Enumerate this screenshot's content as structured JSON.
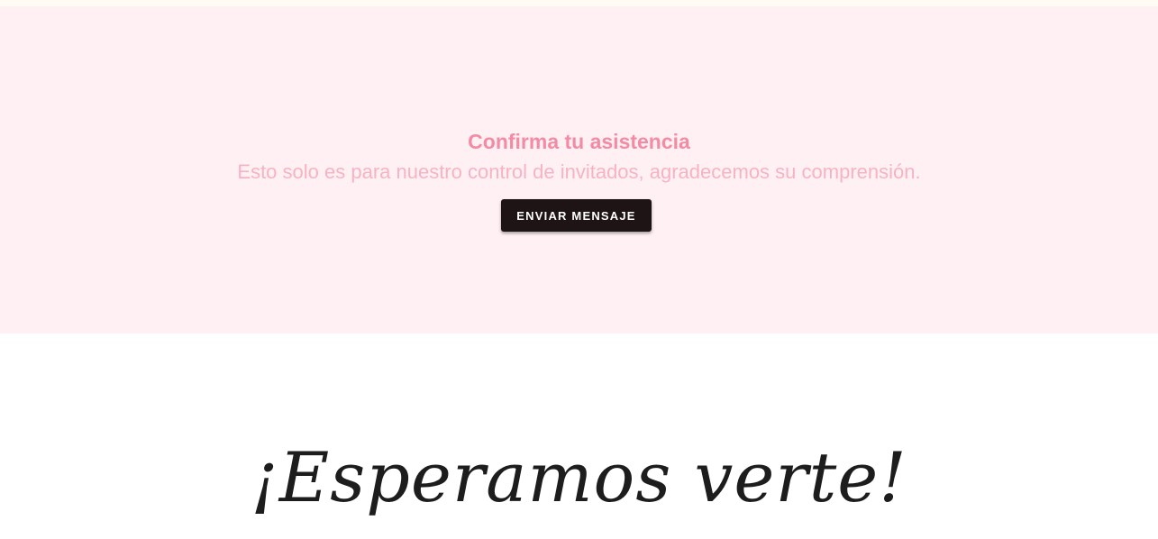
{
  "rsvp": {
    "title": "Confirma tu asistencia",
    "subtitle": "Esto solo es para nuestro control de invitados, agradecemos su comprensión.",
    "button_label": "ENVIAR MENSAJE"
  },
  "closing": {
    "heading": "¡Esperamos verte!"
  },
  "colors": {
    "section_background": "#fff0f3",
    "title": "#f48ba4",
    "subtitle": "#f7b3c4",
    "button_background": "#1e1315",
    "heading": "#1d1d1d"
  }
}
